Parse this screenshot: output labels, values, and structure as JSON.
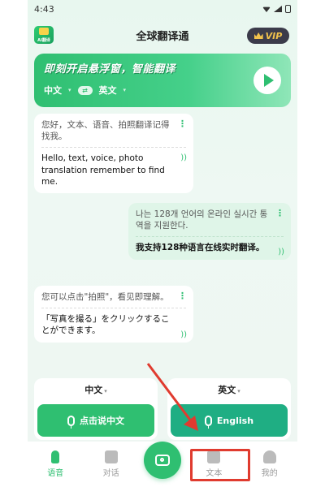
{
  "status_bar": {
    "time": "4:43"
  },
  "header": {
    "title": "全球翻译通",
    "logo_label": "AI翻译",
    "vip_label": "VIP"
  },
  "banner": {
    "title": "即刻开启悬浮窗，智能翻译",
    "source_lang": "中文",
    "target_lang": "英文"
  },
  "messages": [
    {
      "side": "left",
      "source": "您好，文本、语音、拍照翻译记得找我。",
      "translation": "Hello, text, voice, photo translation remember to find me."
    },
    {
      "side": "right",
      "source": "나는 128개 언어의 온라인 실시간 통역을 지원한다.",
      "translation": "我支持128种语言在线实时翻译。"
    },
    {
      "side": "left",
      "source": "您可以点击\"拍照\"，看见即理解。",
      "translation": "「写真を撮る」をクリックすることができます。"
    }
  ],
  "record": {
    "left_lang": "中文",
    "right_lang": "英文",
    "left_button": "点击说中文",
    "right_button": "English"
  },
  "nav": {
    "items": [
      {
        "label": "语音"
      },
      {
        "label": "对话"
      },
      {
        "label": ""
      },
      {
        "label": "文本"
      },
      {
        "label": "我的"
      }
    ]
  },
  "icons": {
    "more": "⋮",
    "speaker": "))"
  },
  "colors": {
    "accent": "#2fbf71",
    "annotation": "#e03b2f"
  }
}
